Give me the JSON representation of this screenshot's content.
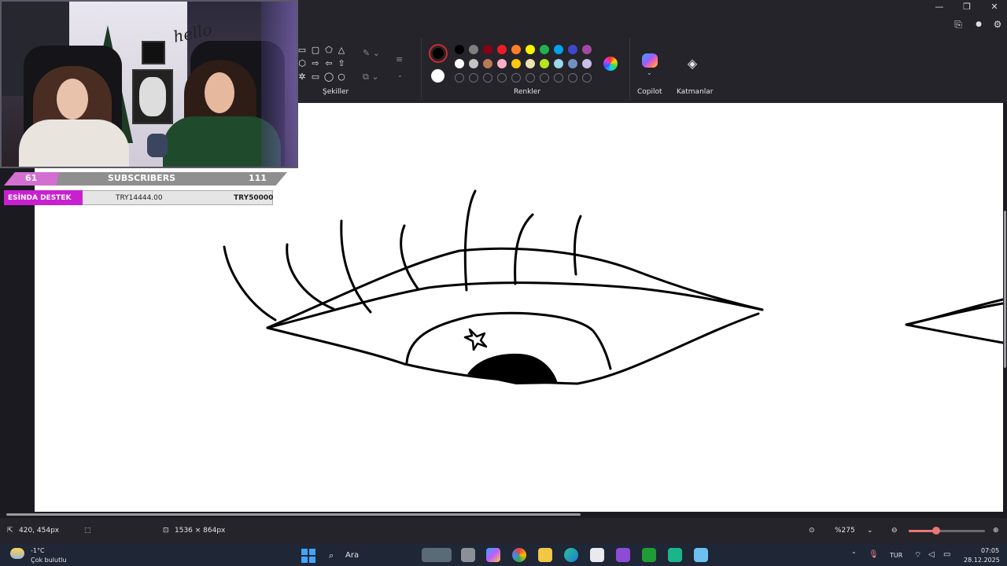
{
  "ribbon": {
    "groups": {
      "shapes_label": "Şekiller",
      "colors_label": "Renkler",
      "copilot_label": "Copilot",
      "layers_label": "Katmanlar"
    },
    "selected_color": "#000000",
    "secondary_color": "#ffffff",
    "palette_row1": [
      "#000000",
      "#7f7f7f",
      "#880015",
      "#ed1c24",
      "#ff7f27",
      "#fff200",
      "#22b14c",
      "#00a2e8",
      "#3f48cc",
      "#a349a4"
    ],
    "palette_row2": [
      "#ffffff",
      "#c3c3c3",
      "#b97a57",
      "#ffaec9",
      "#ffc90e",
      "#efe4b0",
      "#b5e61d",
      "#99d9ea",
      "#7092be",
      "#c8bfe7"
    ]
  },
  "stream_overlay": {
    "sub_left": "61",
    "sub_label": "SUBSCRIBERS",
    "sub_right": "111",
    "donation_label": "ESİNDA DESTEK",
    "donation_current": "TRY14444.00",
    "donation_goal": "TRY50000",
    "poster_text": "hello"
  },
  "statusbar": {
    "cursor_pos": "420, 454px",
    "canvas_size": "1536 × 864px",
    "zoom": "%275",
    "zoom_level_fraction": 0.36
  },
  "taskbar": {
    "weather_temp": "-1°C",
    "weather_desc": "Çok bulutlu",
    "search_label": "Ara",
    "lang": "TUR",
    "time": "07:05",
    "date": "28.12.2025"
  },
  "icons": [
    "minimize-icon",
    "restore-icon",
    "close-icon",
    "share-icon",
    "account-icon",
    "settings-icon",
    "layers-icon",
    "copilot-icon",
    "pointer-icon",
    "selection-icon",
    "canvas-size-icon",
    "fit-icon",
    "zoom-out-icon",
    "zoom-in-icon",
    "windows-icon",
    "search-icon"
  ]
}
